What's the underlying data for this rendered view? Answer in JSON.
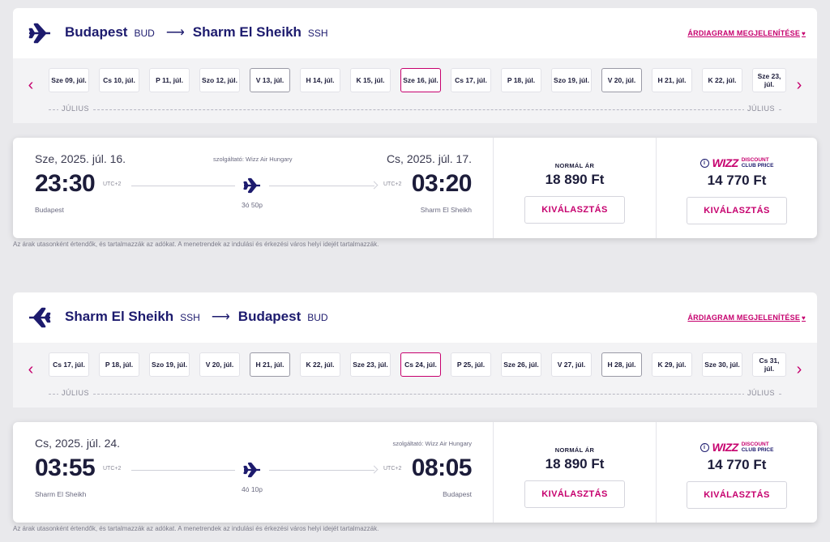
{
  "outbound": {
    "from_city": "Budapest",
    "from_code": "BUD",
    "arrow": "⟶",
    "to_city": "Sharm El Sheikh",
    "to_code": "SSH",
    "price_chart_link": "ÁRDIAGRAM MEGJELENÍTÉSE",
    "dates": [
      {
        "label": "Sze 09, júl.",
        "state": "unavailable"
      },
      {
        "label": "Cs 10, júl.",
        "state": "unavailable"
      },
      {
        "label": "P 11, júl.",
        "state": "unavailable"
      },
      {
        "label": "Szo 12, júl.",
        "state": "unavailable"
      },
      {
        "label": "V 13, júl.",
        "state": "available"
      },
      {
        "label": "H 14, júl.",
        "state": "unavailable"
      },
      {
        "label": "K 15, júl.",
        "state": "unavailable"
      },
      {
        "label": "Sze 16, júl.",
        "state": "selected"
      },
      {
        "label": "Cs 17, júl.",
        "state": "unavailable"
      },
      {
        "label": "P 18, júl.",
        "state": "unavailable"
      },
      {
        "label": "Szo 19, júl.",
        "state": "unavailable"
      },
      {
        "label": "V 20, júl.",
        "state": "available"
      },
      {
        "label": "H 21, júl.",
        "state": "unavailable"
      },
      {
        "label": "K 22, júl.",
        "state": "unavailable"
      },
      {
        "label": "Sze 23, júl.",
        "state": "unavailable"
      }
    ],
    "month_left": "JÚLIUS",
    "month_right": "JÚLIUS",
    "flight": {
      "dep_date": "Sze, 2025. júl. 16.",
      "arr_date": "Cs, 2025. júl. 17.",
      "operator": "szolgáltató: Wizz Air Hungary",
      "dep_time": "23:30",
      "arr_time": "03:20",
      "dep_utc": "UTC+2",
      "arr_utc": "UTC+2",
      "duration": "3ó 50p",
      "dep_city": "Budapest",
      "arr_city": "Sharm El Sheikh"
    },
    "fares": {
      "normal_label": "NORMÁL ÁR",
      "normal_price": "18 890 Ft",
      "club_price": "14 770 Ft",
      "select_label": "KIVÁLASZTÁS"
    },
    "footnote": "Az árak utasonként értendők, és tartalmazzák az adókat. A menetrendek az indulási és érkezési város helyi idejét tartalmazzák."
  },
  "return": {
    "from_city": "Sharm El Sheikh",
    "from_code": "SSH",
    "arrow": "⟶",
    "to_city": "Budapest",
    "to_code": "BUD",
    "price_chart_link": "ÁRDIAGRAM MEGJELENÍTÉSE",
    "dates": [
      {
        "label": "Cs 17, júl.",
        "state": "unavailable"
      },
      {
        "label": "P 18, júl.",
        "state": "unavailable"
      },
      {
        "label": "Szo 19, júl.",
        "state": "unavailable"
      },
      {
        "label": "V 20, júl.",
        "state": "unavailable"
      },
      {
        "label": "H 21, júl.",
        "state": "available"
      },
      {
        "label": "K 22, júl.",
        "state": "unavailable"
      },
      {
        "label": "Sze 23, júl.",
        "state": "unavailable"
      },
      {
        "label": "Cs 24, júl.",
        "state": "selected"
      },
      {
        "label": "P 25, júl.",
        "state": "unavailable"
      },
      {
        "label": "Sze 26, júl.",
        "state": "unavailable"
      },
      {
        "label": "V 27, júl.",
        "state": "unavailable"
      },
      {
        "label": "H 28, júl.",
        "state": "available"
      },
      {
        "label": "K 29, júl.",
        "state": "unavailable"
      },
      {
        "label": "Sze 30, júl.",
        "state": "unavailable"
      },
      {
        "label": "Cs 31, júl.",
        "state": "unavailable"
      }
    ],
    "month_left": "JÚLIUS",
    "month_right": "JÚLIUS",
    "flight": {
      "dep_date": "Cs, 2025. júl. 24.",
      "operator": "szolgáltató: Wizz Air Hungary",
      "dep_time": "03:55",
      "arr_time": "08:05",
      "dep_utc": "UTC+2",
      "arr_utc": "UTC+2",
      "duration": "4ó 10p",
      "dep_city": "Sharm El Sheikh",
      "arr_city": "Budapest"
    },
    "fares": {
      "normal_label": "NORMÁL ÁR",
      "normal_price": "18 890 Ft",
      "club_price": "14 770 Ft",
      "select_label": "KIVÁLASZTÁS"
    },
    "footnote": "Az árak utasonként értendők, és tartalmazzák az adókat. A menetrendek az indulási és érkezési város helyi idejét tartalmazzák."
  },
  "club_logo": {
    "info": "i",
    "wordmark": "WIZZ",
    "line1": "DISCOUNT",
    "line2": "CLUB PRICE"
  },
  "ui": {
    "heart": "♥",
    "nav_prev": "‹",
    "nav_next": "›",
    "accent": "#c6006e",
    "brand_blue": "#1d1b6e"
  }
}
